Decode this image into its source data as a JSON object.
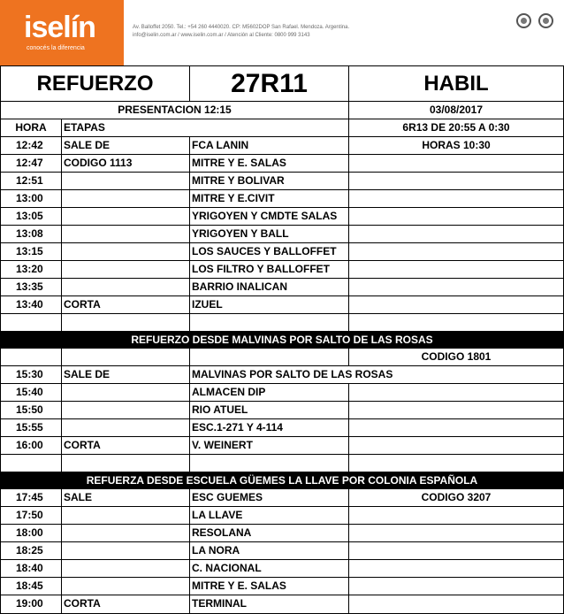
{
  "header": {
    "logo_text": "iselín",
    "logo_tagline": "conocés la diferencia",
    "address_line1": "Av. Balloffet 2050. Tel.: +54 260 4440020. CP: M5602DOP San Rafael. Mendoza. Argentina.",
    "address_line2": "info@iselin.com.ar / www.iselin.com.ar / Atención al Cliente: 0800 999 3143",
    "brand_color": "#ee7320"
  },
  "title": {
    "type": "REFUERZO",
    "route": "27R11",
    "day": "HABIL"
  },
  "presentation": {
    "label": "PRESENTACION 12:15",
    "date": "03/08/2017",
    "shift": "6R13 DE 20:55 A 0:30",
    "hours": "HORAS  10:30"
  },
  "columns": {
    "time": "HORA",
    "stage": "ETAPAS"
  },
  "section1": {
    "rows": [
      {
        "time": "12:42",
        "action": "SALE DE",
        "place": "FCA  LANIN"
      },
      {
        "time": "12:47",
        "action": "CODIGO 1113",
        "place": "MITRE Y E. SALAS"
      },
      {
        "time": "12:51",
        "action": "",
        "place": "MITRE Y BOLIVAR"
      },
      {
        "time": "13:00",
        "action": "",
        "place": "MITRE Y E.CIVIT"
      },
      {
        "time": "13:05",
        "action": "",
        "place": "YRIGOYEN Y CMDTE SALAS"
      },
      {
        "time": "13:08",
        "action": "",
        "place": "YRIGOYEN Y BALL"
      },
      {
        "time": "13:15",
        "action": "",
        "place": "LOS SAUCES Y BALLOFFET"
      },
      {
        "time": "13:20",
        "action": "",
        "place": "LOS FILTRO Y BALLOFFET"
      },
      {
        "time": "13:35",
        "action": "",
        "place": "BARRIO INALICAN"
      },
      {
        "time": "13:40",
        "action": "CORTA",
        "place": "IZUEL"
      }
    ]
  },
  "section2": {
    "heading": "REFUERZO DESDE  MALVINAS POR SALTO DE LAS ROSAS",
    "code": "CODIGO 1801",
    "rows": [
      {
        "time": "15:30",
        "action": "SALE DE",
        "place": "MALVINAS POR SALTO DE LAS ROSAS"
      },
      {
        "time": "15:40",
        "action": "",
        "place": "ALMACEN DIP"
      },
      {
        "time": "15:50",
        "action": "",
        "place": "RIO ATUEL"
      },
      {
        "time": "15:55",
        "action": "",
        "place": "ESC.1-271  Y 4-114"
      },
      {
        "time": "16:00",
        "action": "CORTA",
        "place": "V. WEINERT"
      }
    ]
  },
  "section3": {
    "heading": "REFUERZA DESDE ESCUELA GÜEMES LA LLAVE POR COLONIA ESPAÑOLA",
    "code": "CODIGO 3207",
    "rows": [
      {
        "time": "17:45",
        "action": "SALE",
        "place": "ESC GUEMES"
      },
      {
        "time": "17:50",
        "action": "",
        "place": "LA LLAVE"
      },
      {
        "time": "18:00",
        "action": "",
        "place": "RESOLANA"
      },
      {
        "time": "18:25",
        "action": "",
        "place": "LA NORA"
      },
      {
        "time": "18:40",
        "action": "",
        "place": "C. NACIONAL"
      },
      {
        "time": "18:45",
        "action": "",
        "place": "MITRE Y E. SALAS"
      },
      {
        "time": "19:00",
        "action": "CORTA",
        "place": "TERMINAL"
      }
    ]
  }
}
